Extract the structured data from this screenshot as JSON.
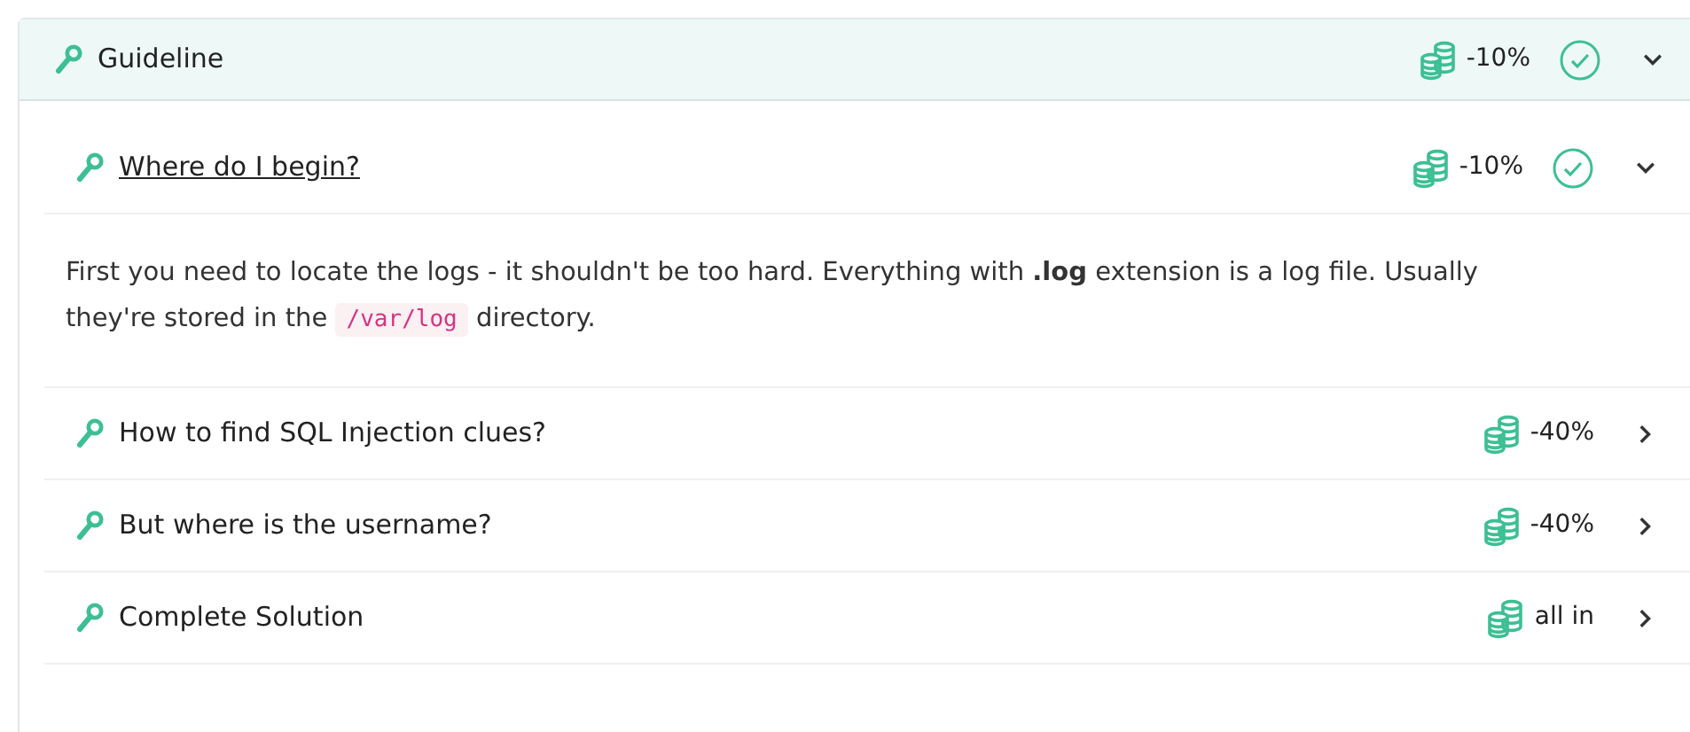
{
  "guideline": {
    "title": "Guideline",
    "cost": "-10%",
    "checked": true,
    "expanded": true
  },
  "hints": [
    {
      "title": "Where do I begin?",
      "cost": "-10%",
      "checked": true,
      "expanded": true,
      "body": [
        {
          "kind": "text",
          "text": "First you need to locate the logs - it shouldn't be too hard. Everything with **.log** extension is a log file. Usually they're stored in the "
        },
        {
          "kind": "code",
          "text": "/var/log"
        },
        {
          "kind": "text",
          "text": " directory."
        }
      ]
    },
    {
      "title": "How to find SQL Injection clues?",
      "cost": "-40%",
      "checked": false,
      "expanded": false
    },
    {
      "title": "But where is the username?",
      "cost": "-40%",
      "checked": false,
      "expanded": false
    },
    {
      "title": "Complete Solution",
      "cost": "all in",
      "checked": false,
      "expanded": false
    }
  ]
}
